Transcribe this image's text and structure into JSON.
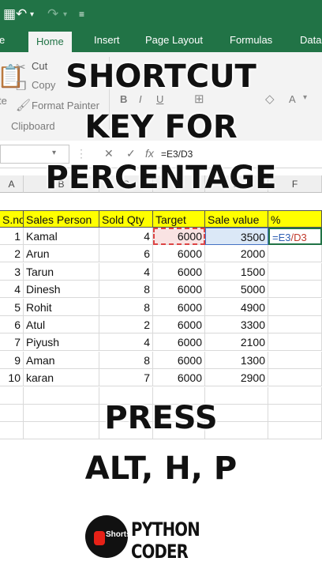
{
  "ribbon_tabs": {
    "partial_left": "e",
    "home": "Home",
    "insert": "Insert",
    "page_layout": "Page Layout",
    "formulas": "Formulas",
    "data_partial": "Data"
  },
  "clipboard": {
    "cut": "Cut",
    "copy": "Copy",
    "format_painter": "Format Painter",
    "group_label": "Clipboard",
    "paste_partial": "te"
  },
  "font_group": {
    "bold": "B",
    "italic": "I",
    "underline": "U",
    "font_color_glyph": "A"
  },
  "formula_bar": {
    "cancel": "✕",
    "enter": "✓",
    "fx": "fx",
    "value": "=E3/D3"
  },
  "columns": [
    "A",
    "B",
    "C",
    "D",
    "E",
    "F"
  ],
  "table": {
    "headers": [
      "S.no",
      "Sales Person",
      "Sold Qty",
      "Target",
      "Sale value",
      "%"
    ],
    "rows": [
      {
        "sno": "1",
        "name": "Kamal",
        "qty": "4",
        "target": "6000",
        "sale": "3500"
      },
      {
        "sno": "2",
        "name": "Arun",
        "qty": "6",
        "target": "6000",
        "sale": "2000"
      },
      {
        "sno": "3",
        "name": "Tarun",
        "qty": "4",
        "target": "6000",
        "sale": "1500"
      },
      {
        "sno": "4",
        "name": "Dinesh",
        "qty": "8",
        "target": "6000",
        "sale": "5000"
      },
      {
        "sno": "5",
        "name": "Rohit",
        "qty": "8",
        "target": "6000",
        "sale": "4900"
      },
      {
        "sno": "6",
        "name": "Atul",
        "qty": "2",
        "target": "6000",
        "sale": "3300"
      },
      {
        "sno": "7",
        "name": "Piyush",
        "qty": "4",
        "target": "6000",
        "sale": "2100"
      },
      {
        "sno": "9",
        "name": "Aman",
        "qty": "8",
        "target": "6000",
        "sale": "1300"
      },
      {
        "sno": "10",
        "name": "karan",
        "qty": "7",
        "target": "6000",
        "sale": "2900"
      }
    ],
    "active_formula_ref1": "=E3",
    "active_formula_ref2": "/D3"
  },
  "overlay": {
    "line1": "SHORTCUT",
    "line2": "KEY FOR",
    "line3": "PERCENTAGE",
    "press": "PRESS",
    "keys": "ALT, H, P"
  },
  "brand": {
    "shorts_label": "Shorts",
    "channel": "PYTHON CODER"
  },
  "colors": {
    "excel_green": "#217346",
    "header_fill": "#ffff00",
    "youtube_red": "#e62117"
  }
}
